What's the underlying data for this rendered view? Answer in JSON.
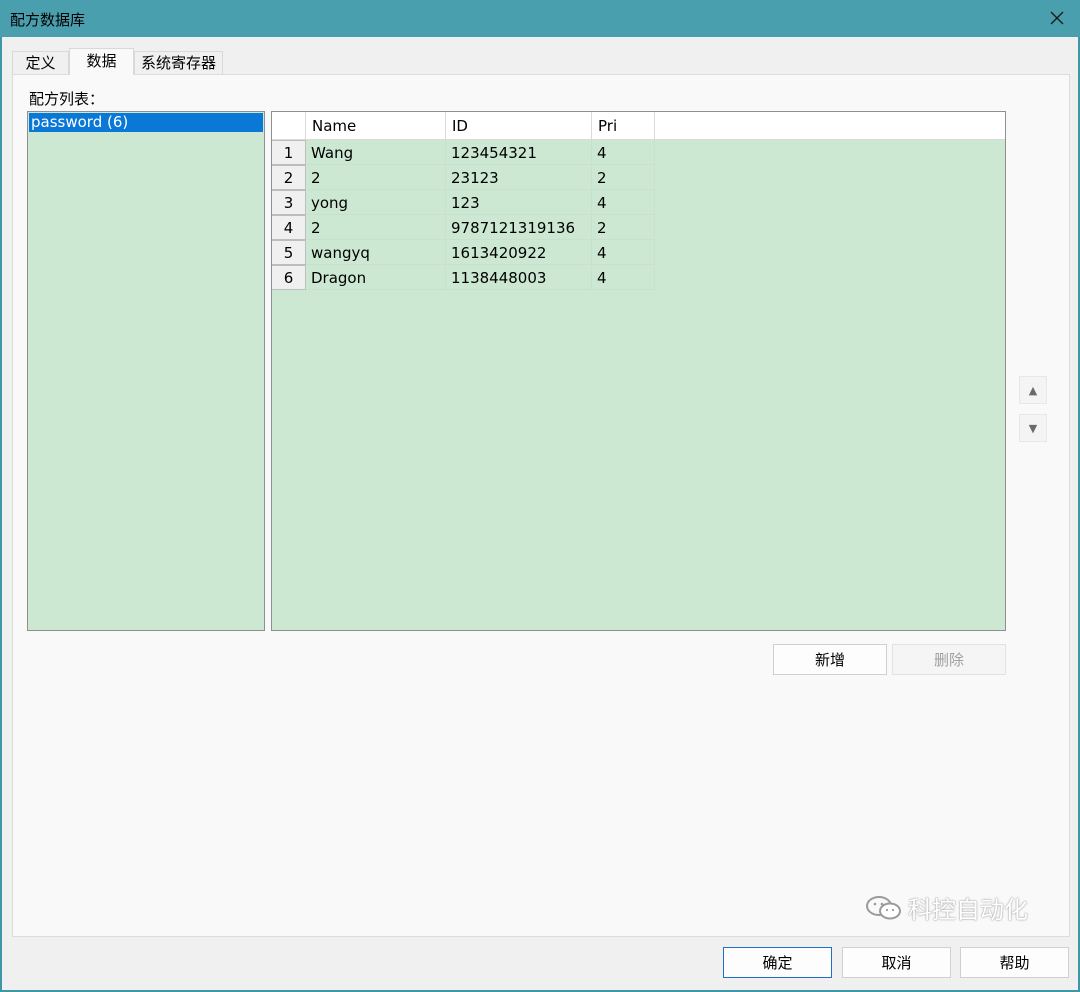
{
  "window": {
    "title": "配方数据库"
  },
  "tabs": [
    {
      "label": "定义"
    },
    {
      "label": "数据"
    },
    {
      "label": "系统寄存器"
    }
  ],
  "recipe_list": {
    "label": "配方列表：",
    "items": [
      {
        "label": "password (6)"
      }
    ]
  },
  "grid": {
    "columns": [
      "Name",
      "ID",
      "Pri"
    ],
    "rows": [
      {
        "num": "1",
        "name": "Wang",
        "id": "123454321",
        "pri": "4"
      },
      {
        "num": "2",
        "name": "2",
        "id": "23123",
        "pri": "2"
      },
      {
        "num": "3",
        "name": "yong",
        "id": "123",
        "pri": "4"
      },
      {
        "num": "4",
        "name": "2",
        "id": "9787121319136",
        "pri": "2"
      },
      {
        "num": "5",
        "name": "wangyq",
        "id": "1613420922",
        "pri": "4"
      },
      {
        "num": "6",
        "name": "Dragon",
        "id": "1138448003",
        "pri": "4"
      }
    ]
  },
  "row_actions": {
    "add_label": "新增",
    "delete_label": "删除"
  },
  "footer": {
    "ok_label": "确定",
    "cancel_label": "取消",
    "help_label": "帮助"
  },
  "watermark": {
    "text": "科控自动化"
  },
  "icons": {
    "close": "close-icon",
    "move_up": "triangle-up-icon",
    "move_down": "triangle-down-icon",
    "wechat": "wechat-icon"
  }
}
